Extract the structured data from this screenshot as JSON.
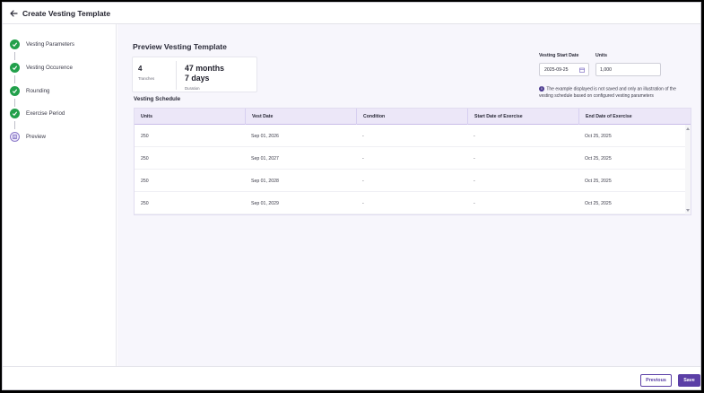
{
  "header": {
    "title": "Create Vesting Template",
    "back_icon": "arrow-left-icon"
  },
  "steps": [
    {
      "label": "Vesting Parameters",
      "status": "completed"
    },
    {
      "label": "Vesting Occurence",
      "status": "completed"
    },
    {
      "label": "Rounding",
      "status": "completed"
    },
    {
      "label": "Exercise Period",
      "status": "completed"
    },
    {
      "label": "Preview",
      "status": "current"
    }
  ],
  "preview": {
    "title": "Preview Vesting Template",
    "tranches_value": "4",
    "tranches_label": "Tranches",
    "duration_line1": "47 months",
    "duration_line2": "7 days",
    "duration_label": "Duration"
  },
  "form": {
    "start_date_label": "Vesting Start Date",
    "start_date_value": "2025-09-25",
    "units_label": "Units",
    "units_value": "1,000",
    "info_note": "The example displayed is not saved and only an illustration of the vesting schedule based on configured vesting parameters"
  },
  "schedule": {
    "title": "Vesting Schedule",
    "columns": [
      "Units",
      "Vest Date",
      "Condition",
      "Start Date of Exercise",
      "End Date of Exercise"
    ],
    "rows": [
      [
        "250",
        "Sep 01, 2026",
        "-",
        "-",
        "Oct 25, 2025"
      ],
      [
        "250",
        "Sep 01, 2027",
        "-",
        "-",
        "Oct 25, 2025"
      ],
      [
        "250",
        "Sep 01, 2028",
        "-",
        "-",
        "Oct 25, 2025"
      ],
      [
        "250",
        "Sep 01, 2029",
        "-",
        "-",
        "Oct 25, 2025"
      ]
    ]
  },
  "footer": {
    "previous_label": "Previous",
    "save_label": "Save"
  },
  "colors": {
    "accent": "#5b3fa6",
    "success": "#22a04b",
    "table_header": "#ece7f8"
  }
}
